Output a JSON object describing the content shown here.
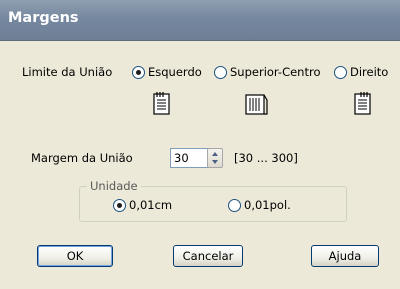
{
  "window": {
    "title": "Margens"
  },
  "binding": {
    "label": "Limite da União",
    "options": [
      {
        "label": "Esquerdo",
        "checked": true,
        "icon": "binding-left-icon"
      },
      {
        "label": "Superior-Centro",
        "checked": false,
        "icon": "binding-top-center-icon"
      },
      {
        "label": "Direito",
        "checked": false,
        "icon": "binding-right-icon"
      }
    ]
  },
  "margin": {
    "label": "Margem da União",
    "value": "30",
    "range": "[30 ... 300]"
  },
  "unit": {
    "label": "Unidade",
    "options": [
      {
        "label": "0,01cm",
        "checked": true
      },
      {
        "label": "0,01pol.",
        "checked": false
      }
    ]
  },
  "buttons": {
    "ok": "OK",
    "cancel": "Cancelar",
    "help": "Ajuda"
  }
}
